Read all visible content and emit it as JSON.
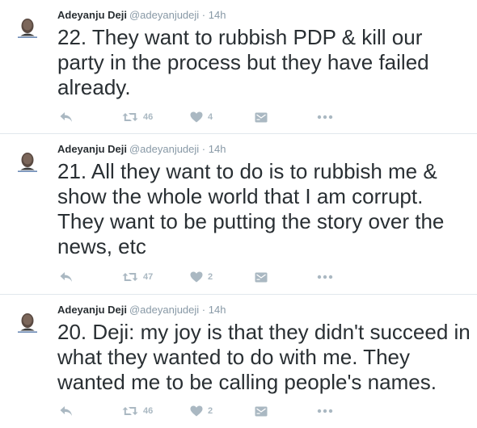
{
  "tweets": [
    {
      "name": "Adeyanju Deji",
      "handle": "@adeyanjudeji",
      "separator": "·",
      "time": "14h",
      "text": "22. They want to rubbish PDP & kill our party in the process but they have failed already.",
      "retweets": "46",
      "likes": "4"
    },
    {
      "name": "Adeyanju Deji",
      "handle": "@adeyanjudeji",
      "separator": "·",
      "time": "14h",
      "text": "21. All they want to do is to rubbish me & show the whole world that I am corrupt. They want to be putting the story over the news, etc",
      "retweets": "47",
      "likes": "2"
    },
    {
      "name": "Adeyanju Deji",
      "handle": "@adeyanjudeji",
      "separator": "·",
      "time": "14h",
      "text": "20. Deji: my joy is that they didn't succeed in what they wanted to do with me. They wanted me to be calling people's names.",
      "retweets": "46",
      "likes": "2"
    }
  ],
  "icons": {
    "reply": "reply-icon",
    "retweet": "retweet-icon",
    "like": "heart-icon",
    "message": "direct-message-icon",
    "more": "more-dots-icon",
    "avatar": "profile-avatar"
  },
  "colors": {
    "text": "#292f33",
    "muted": "#8899a6",
    "action_icon": "#aab8c2",
    "divider": "#e1e8ed"
  }
}
